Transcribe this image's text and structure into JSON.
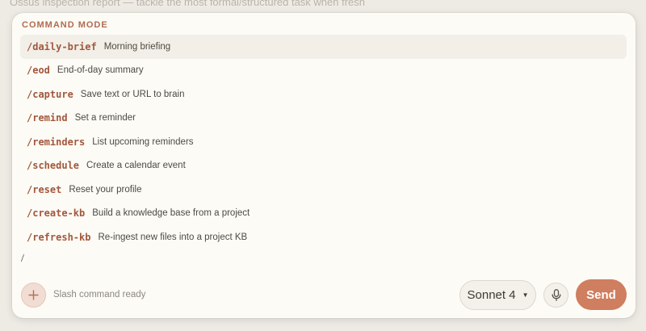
{
  "background": {
    "text": "Ossus inspection report — tackle the most formal/structured task when fresh"
  },
  "command_mode": {
    "title": "COMMAND MODE",
    "commands": [
      {
        "name": "/daily-brief",
        "description": "Morning briefing"
      },
      {
        "name": "/eod",
        "description": "End-of-day summary"
      },
      {
        "name": "/capture",
        "description": "Save text or URL to brain"
      },
      {
        "name": "/remind",
        "description": "Set a reminder"
      },
      {
        "name": "/reminders",
        "description": "List upcoming reminders"
      },
      {
        "name": "/schedule",
        "description": "Create a calendar event"
      },
      {
        "name": "/reset",
        "description": "Reset your profile"
      },
      {
        "name": "/create-kb",
        "description": "Build a knowledge base from a project"
      },
      {
        "name": "/refresh-kb",
        "description": "Re-ingest new files into a project KB"
      }
    ]
  },
  "input": {
    "value": "/"
  },
  "bottom_bar": {
    "add_icon": "plus-icon",
    "status": "Slash command ready",
    "model": "Sonnet 4",
    "mic_icon": "microphone-icon",
    "send_label": "Send"
  },
  "colors": {
    "accent": "#cf7e5f",
    "command_text": "#a2583c",
    "title": "#b26b4e",
    "panel": "#fdfbf6"
  }
}
